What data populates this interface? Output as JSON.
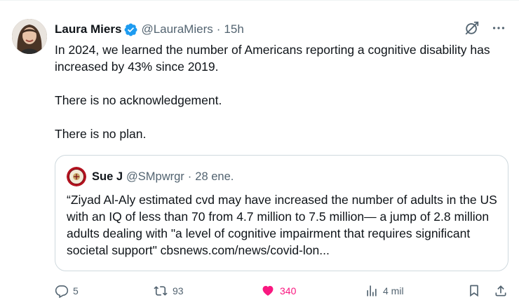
{
  "tweet": {
    "author": {
      "display_name": "Laura Miers",
      "handle": "@LauraMiers",
      "separator": "·",
      "time": "15h"
    },
    "paragraphs": [
      "In 2024, we learned the number of Americans reporting a cognitive disability has increased by 43% since 2019.",
      "There is no acknowledgement.",
      "There is no plan."
    ],
    "quote": {
      "display_name": "Sue J",
      "handle": "@SMpwrgr",
      "separator": "·",
      "time": "28 ene.",
      "text": "“Ziyad Al-Aly estimated cvd may have increased the number of adults in the US with an IQ of less than 70 from 4.7 million to 7.5 million— a jump of 2.8 million adults dealing with \"a level of cognitive impairment that requires significant societal support\" cbsnews.com/news/covid-lon..."
    },
    "metrics": {
      "replies": "5",
      "retweets": "93",
      "likes": "340",
      "views": "4 mil"
    }
  },
  "colors": {
    "text": "#0f1419",
    "secondary": "#536471",
    "verified": "#1d9bf0",
    "like": "#f91880",
    "border": "#cfd9de"
  },
  "icons": {
    "verified": "verified-badge-icon",
    "grok": "grok-icon",
    "more": "more-icon",
    "reply": "reply-icon",
    "retweet": "retweet-icon",
    "like": "heart-icon",
    "views": "views-icon",
    "bookmark": "bookmark-icon",
    "share": "share-icon"
  }
}
